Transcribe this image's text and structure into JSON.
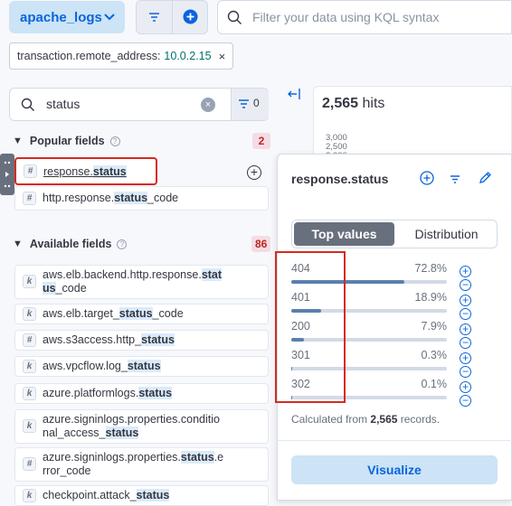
{
  "header": {
    "data_view": "apache_logs",
    "kql_placeholder": "Filter your data using KQL syntax"
  },
  "filter_pill": {
    "field": "transaction.remote_address:",
    "value": "10.0.2.15",
    "remove": "×"
  },
  "sidebar": {
    "search_value": "status",
    "filter_count": "0",
    "popular": {
      "title": "Popular fields",
      "count": "2",
      "fields": [
        {
          "type": "#",
          "pre": "response.",
          "hl": "status",
          "post": ""
        },
        {
          "type": "#",
          "pre": "http.response.",
          "hl": "status",
          "post": "_code"
        }
      ]
    },
    "available": {
      "title": "Available fields",
      "count": "86",
      "fields": [
        {
          "type": "k",
          "pre": "aws.elb.backend.http.response.",
          "hl": "stat",
          "post": "",
          "line2_hl": "us",
          "line2_post": "_code"
        },
        {
          "type": "k",
          "pre": "aws.elb.target_",
          "hl": "status",
          "post": "_code"
        },
        {
          "type": "#",
          "pre": "aws.s3access.http_",
          "hl": "status",
          "post": ""
        },
        {
          "type": "k",
          "pre": "aws.vpcflow.log_",
          "hl": "status",
          "post": ""
        },
        {
          "type": "k",
          "pre": "azure.platformlogs.",
          "hl": "status",
          "post": ""
        },
        {
          "type": "k",
          "pre": "azure.signinlogs.properties.conditio",
          "hl": "",
          "post": "",
          "line2_pre": "nal_access_",
          "line2_hl": "status",
          "line2_post": ""
        },
        {
          "type": "#",
          "pre": "azure.signinlogs.properties.",
          "hl": "status",
          "post": ".e",
          "line2_pre": "rror_code",
          "line2_hl": "",
          "line2_post": ""
        },
        {
          "type": "k",
          "pre": "checkpoint.attack_",
          "hl": "status",
          "post": ""
        }
      ]
    }
  },
  "hits": {
    "count": "2,565",
    "label": "hits",
    "y_ticks": [
      "3,000",
      "2,500",
      "2,000"
    ]
  },
  "popover": {
    "title": "response.status",
    "tabs": [
      "Top values",
      "Distribution"
    ],
    "values": [
      {
        "label": "404",
        "pct": "72.8%",
        "frac": 0.728
      },
      {
        "label": "401",
        "pct": "18.9%",
        "frac": 0.189
      },
      {
        "label": "200",
        "pct": "7.9%",
        "frac": 0.079
      },
      {
        "label": "301",
        "pct": "0.3%",
        "frac": 0.003
      },
      {
        "label": "302",
        "pct": "0.1%",
        "frac": 0.001
      }
    ],
    "calc_prefix": "Calculated from",
    "calc_count": "2,565",
    "calc_suffix": "records.",
    "visualize": "Visualize"
  }
}
